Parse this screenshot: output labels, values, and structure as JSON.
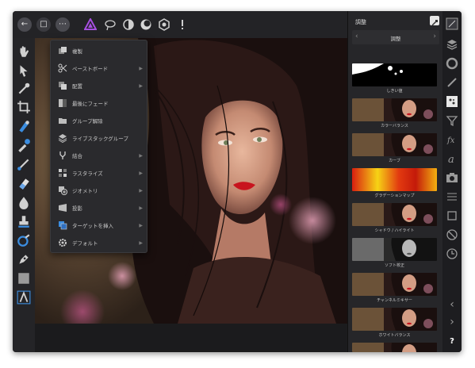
{
  "menu": {
    "items": [
      {
        "label": "複製",
        "has_submenu": false
      },
      {
        "label": "ペーストボード",
        "has_submenu": true
      },
      {
        "label": "配置",
        "has_submenu": true
      },
      {
        "label": "最後にフェード",
        "has_submenu": false
      },
      {
        "label": "グループ解除",
        "has_submenu": false
      },
      {
        "label": "ライブスタックグループ",
        "has_submenu": false
      },
      {
        "label": "結合",
        "has_submenu": true
      },
      {
        "label": "ラスタライズ",
        "has_submenu": true
      },
      {
        "label": "ジオメトリ",
        "has_submenu": true
      },
      {
        "label": "投影",
        "has_submenu": true
      },
      {
        "label": "ターゲットを挿入",
        "has_submenu": true
      },
      {
        "label": "デフォルト",
        "has_submenu": true
      }
    ]
  },
  "panel": {
    "title": "調整",
    "nav_label": "調整",
    "adjustments": [
      {
        "label": "しきい値",
        "style": "threshold"
      },
      {
        "label": "カラーバランス",
        "style": "photo"
      },
      {
        "label": "カーブ",
        "style": "photo"
      },
      {
        "label": "グラデーションマップ",
        "style": "gradient"
      },
      {
        "label": "シャドウ / ハイライト",
        "style": "photo"
      },
      {
        "label": "ソフト校正",
        "style": "mono"
      },
      {
        "label": "チャンネルミキサー",
        "style": "photo"
      },
      {
        "label": "ホワイトバランス",
        "style": "photo"
      },
      {
        "label": "",
        "style": "photo"
      }
    ]
  },
  "right_rail": {
    "help_label": "?"
  },
  "colors": {
    "accent": "#3b8de0",
    "app_bg": "#1f1f22",
    "panel_bg": "#262629",
    "gradient_map_red": "#d81e10",
    "gradient_map_yellow": "#f6d315"
  }
}
